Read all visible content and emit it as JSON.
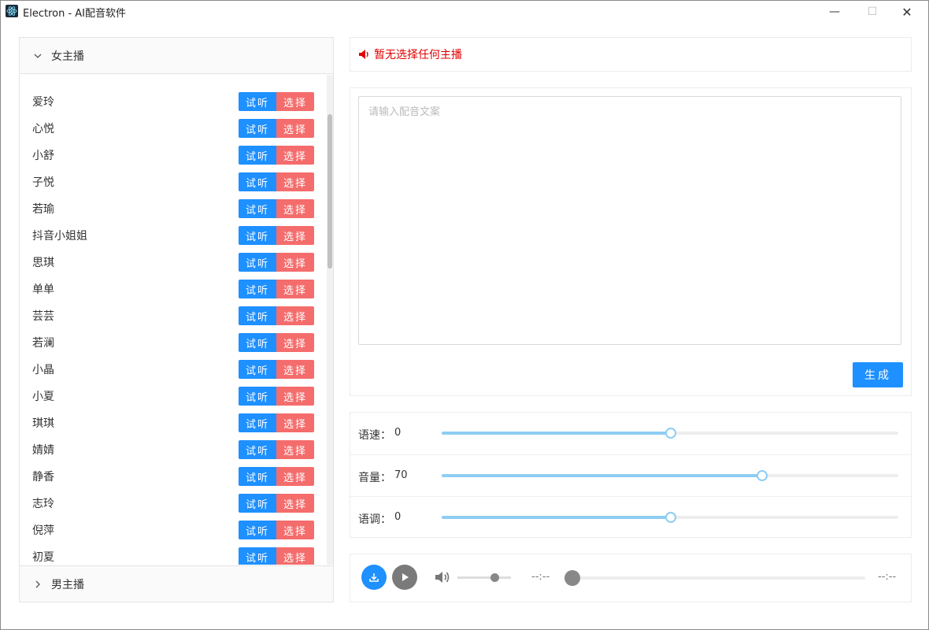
{
  "window": {
    "title": "Electron - AI配音软件",
    "minimize": "—",
    "maximize": "☐",
    "close": "✕"
  },
  "sidebar": {
    "female_group": "女主播",
    "male_group": "男主播",
    "listen_label": "试听",
    "choose_label": "选择",
    "female_anchors": [
      "爱玲",
      "心悦",
      "小舒",
      "子悦",
      "若瑜",
      "抖音小姐姐",
      "思琪",
      "单单",
      "芸芸",
      "若澜",
      "小晶",
      "小夏",
      "琪琪",
      "婧婧",
      "静香",
      "志玲",
      "倪萍",
      "初夏"
    ],
    "scroll_fraction": 0.08
  },
  "status": {
    "message": "暂无选择任何主播",
    "color": "#e00000"
  },
  "editor": {
    "placeholder": "请输入配音文案",
    "value": "",
    "generate_label": "生成"
  },
  "sliders": [
    {
      "label": "语速：",
      "value": "0",
      "fraction": 0.5
    },
    {
      "label": "音量：",
      "value": "70",
      "fraction": 0.7
    },
    {
      "label": "语调：",
      "value": "0",
      "fraction": 0.5
    }
  ],
  "player": {
    "current_time": "--:--",
    "total_time": "--:--",
    "volume_fraction": 0.7,
    "progress_fraction": 0.0
  },
  "colors": {
    "primary": "#1e90ff",
    "danger": "#f56c6c",
    "slider": "#8ecdf3"
  },
  "icons": {
    "download": "download-icon",
    "play": "play-icon",
    "volume": "volume-icon",
    "speaker": "speaker-icon"
  }
}
